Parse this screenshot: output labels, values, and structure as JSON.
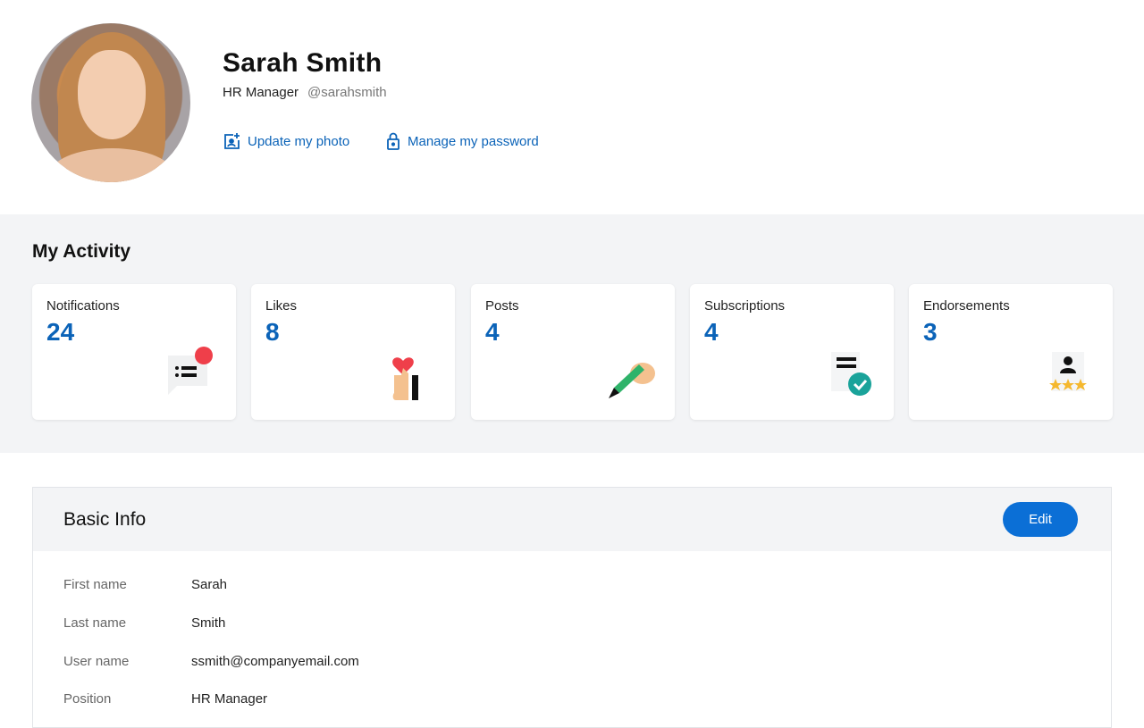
{
  "profile": {
    "name": "Sarah Smith",
    "role": "HR Manager",
    "handle": "@sarahsmith",
    "update_photo": "Update my photo",
    "manage_password": "Manage my password"
  },
  "activity": {
    "title": "My Activity",
    "cards": [
      {
        "label": "Notifications",
        "value": "24",
        "icon": "notification-list-icon"
      },
      {
        "label": "Likes",
        "value": "8",
        "icon": "heart-hand-icon"
      },
      {
        "label": "Posts",
        "value": "4",
        "icon": "pencil-hand-icon"
      },
      {
        "label": "Subscriptions",
        "value": "4",
        "icon": "document-check-icon"
      },
      {
        "label": "Endorsements",
        "value": "3",
        "icon": "person-stars-icon"
      }
    ]
  },
  "basic_info": {
    "title": "Basic Info",
    "edit_label": "Edit",
    "rows": [
      {
        "label": "First name",
        "value": "Sarah"
      },
      {
        "label": "Last name",
        "value": "Smith"
      },
      {
        "label": "User name",
        "value": "ssmith@companyemail.com"
      },
      {
        "label": "Position",
        "value": "HR Manager"
      }
    ]
  },
  "colors": {
    "accent": "#0b63b8",
    "button": "#0b6fd6"
  }
}
